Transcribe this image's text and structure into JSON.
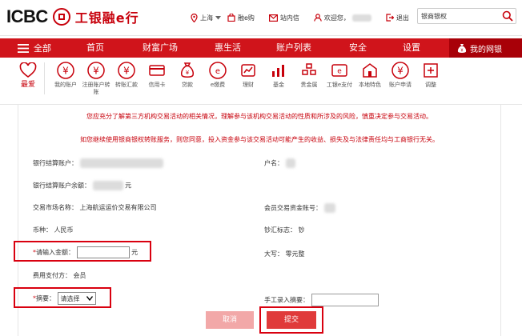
{
  "brand": {
    "logo_text": "ICBC",
    "logo_cn": "工银融e行"
  },
  "top_links": {
    "city": "上海",
    "rong_e_you": "融e购",
    "messages": "站内信",
    "welcome": "欢迎您，",
    "logout": "退出"
  },
  "search": {
    "value": "银商银权"
  },
  "nav": {
    "items": [
      "全部",
      "首页",
      "财富广场",
      "惠生活",
      "账户列表",
      "安全",
      "设置"
    ],
    "mybank": "我的网银"
  },
  "icon_row": {
    "fav": "最爱",
    "items": [
      {
        "label": "我的账户",
        "icon": "yen-circle-icon"
      },
      {
        "label": "注册账户转账",
        "icon": "yen-circle-icon"
      },
      {
        "label": "转账汇款",
        "icon": "yen-circle-icon"
      },
      {
        "label": "信用卡",
        "icon": "card-icon"
      },
      {
        "label": "贷款",
        "icon": "money-bag-icon"
      },
      {
        "label": "e缴费",
        "icon": "e-pay-icon"
      },
      {
        "label": "理财",
        "icon": "finance-icon"
      },
      {
        "label": "基金",
        "icon": "chart-icon"
      },
      {
        "label": "贵金属",
        "icon": "gold-icon"
      },
      {
        "label": "工银e支付",
        "icon": "e-pay-card-icon"
      },
      {
        "label": "本地特色",
        "icon": "local-icon"
      },
      {
        "label": "账户申请",
        "icon": "yen-circle-icon"
      },
      {
        "label": "调整",
        "icon": "plus-box-icon"
      }
    ]
  },
  "notice": {
    "line1": "您应充分了解第三方机构交易活动的相关情况，理解参与该机构交易活动的性质和所涉及的风险，慎重决定参与交易活动。",
    "line2": "如您继续使用银商银权转账服务，则您同意，投入资金参与该交易活动可能产生的收益、损失及与法律责任均与工商银行无关。"
  },
  "form": {
    "bank_account_label": "银行结算账户：",
    "name_label": "户名：",
    "balance_label": "银行结算账户余额：",
    "balance_unit": "元",
    "market_label": "交易市场名称：",
    "market_value": "上海航运运价交易有限公司",
    "member_account_label": "会员交易资金账号：",
    "currency_label": "币种：",
    "currency_value": "人民币",
    "cash_label": "钞汇标志：",
    "cash_value": "钞",
    "amount_required": "*",
    "amount_label": "请输入金额：",
    "amount_unit": "元",
    "capital_label": "大写：",
    "capital_value": "零元整",
    "fee_label": "费用支付方：",
    "fee_value": "会员",
    "summary_required": "*",
    "summary_label": "摘要：",
    "summary_selected": "请选择",
    "manual_label": "手工录入摘要："
  },
  "buttons": {
    "cancel": "取消",
    "submit": "提交"
  },
  "colors": {
    "brand_red": "#d0141b",
    "dark_red": "#a80008",
    "highlight": "#d9000f"
  }
}
